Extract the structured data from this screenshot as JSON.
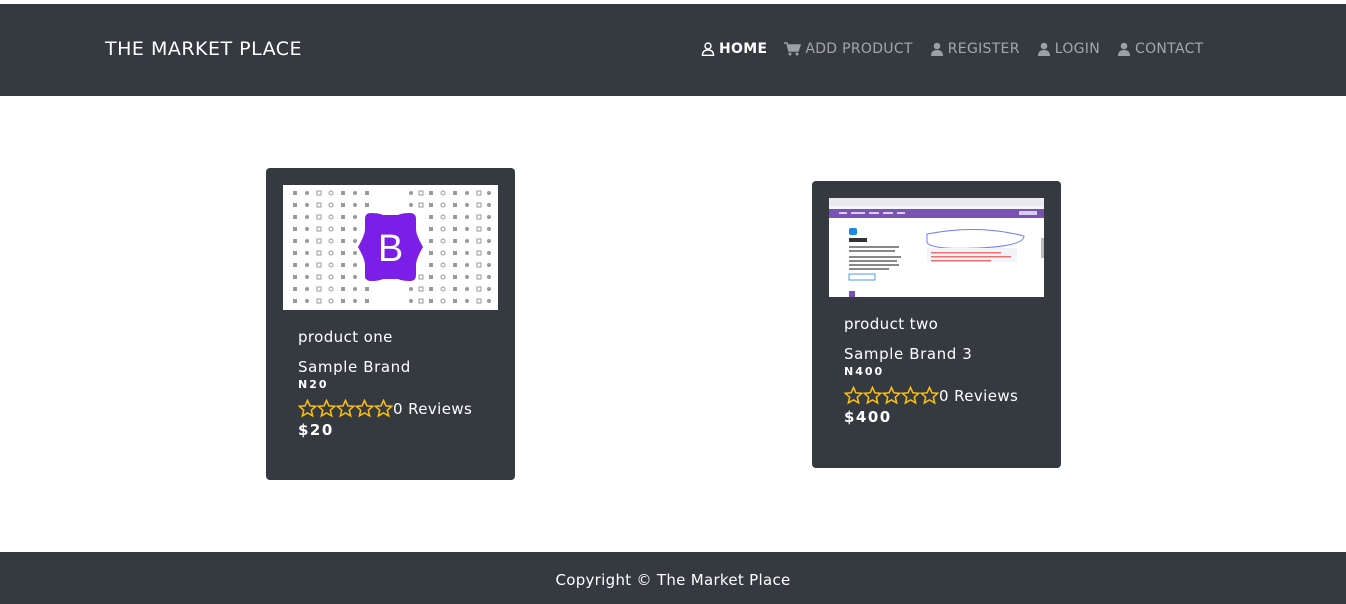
{
  "navbar": {
    "brand": "THE MARKET PLACE",
    "links": [
      {
        "label": "HOME",
        "icon": "user-outline-icon",
        "active": true
      },
      {
        "label": "ADD PRODUCT",
        "icon": "cart-icon",
        "active": false
      },
      {
        "label": "REGISTER",
        "icon": "user-icon",
        "active": false
      },
      {
        "label": "LOGIN",
        "icon": "user-icon",
        "active": false
      },
      {
        "label": "CONTACT",
        "icon": "user-icon",
        "active": false
      }
    ]
  },
  "products": [
    {
      "name": "product one",
      "brand": "Sample Brand",
      "code": "N20",
      "rating": 0,
      "reviews": "0 Reviews",
      "price": "$20",
      "image": "bootstrap-logo-image"
    },
    {
      "name": "product two",
      "brand": "Sample Brand 3",
      "code": "N400",
      "rating": 0,
      "reviews": "0 Reviews",
      "price": "$400",
      "image": "jsdelivr-screenshot-image"
    }
  ],
  "footer": {
    "copyright": "Copyright © The Market Place"
  },
  "colors": {
    "dark": "#343a40",
    "star": "#ffc107",
    "bootstrap_purple": "#7952b3"
  }
}
